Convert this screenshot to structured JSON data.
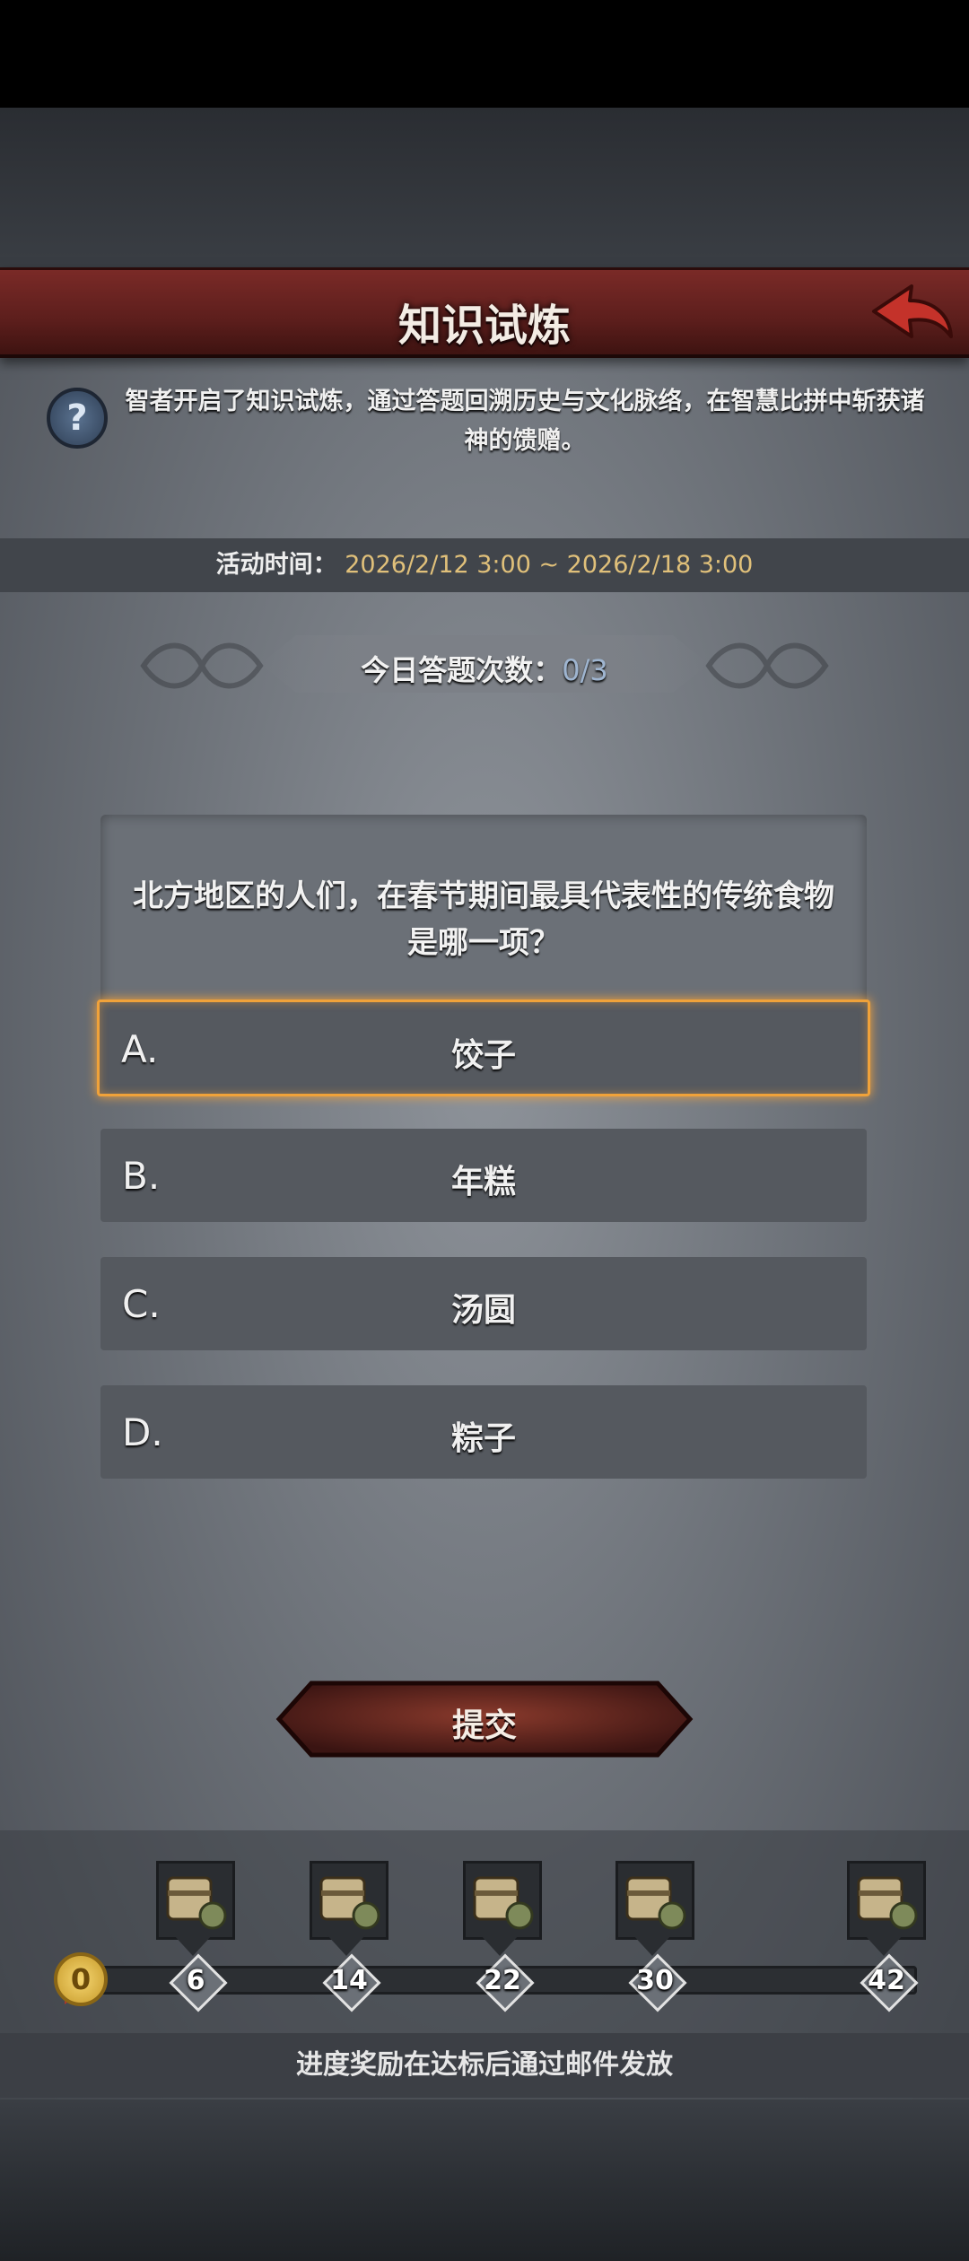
{
  "header": {
    "title": "知识试炼"
  },
  "intro": {
    "text": "智者开启了知识试炼，通过答题回溯历史与文化脉络，在智慧比拼中斩获诸神的馈赠。"
  },
  "activity": {
    "label": "活动时间：",
    "value": "2026/2/12 3:00 ~ 2026/2/18 3:00"
  },
  "daily": {
    "label": "今日答题次数：",
    "value": "0/3"
  },
  "question": {
    "text": "北方地区的人们，在春节期间最具代表性的传统食物是哪一项？"
  },
  "options": [
    {
      "letter": "A.",
      "text": "饺子",
      "selected": true
    },
    {
      "letter": "B.",
      "text": "年糕",
      "selected": false
    },
    {
      "letter": "C.",
      "text": "汤圆",
      "selected": false
    },
    {
      "letter": "D.",
      "text": "粽子",
      "selected": false
    }
  ],
  "submit": {
    "label": "提交"
  },
  "progress": {
    "current": "0",
    "milestones": [
      "6",
      "14",
      "22",
      "30",
      "42"
    ],
    "note": "进度奖励在达标后通过邮件发放"
  },
  "colors": {
    "accent_red": "#6a2320",
    "highlight_orange": "#f0a23a",
    "date_gold": "#e0c07a"
  }
}
